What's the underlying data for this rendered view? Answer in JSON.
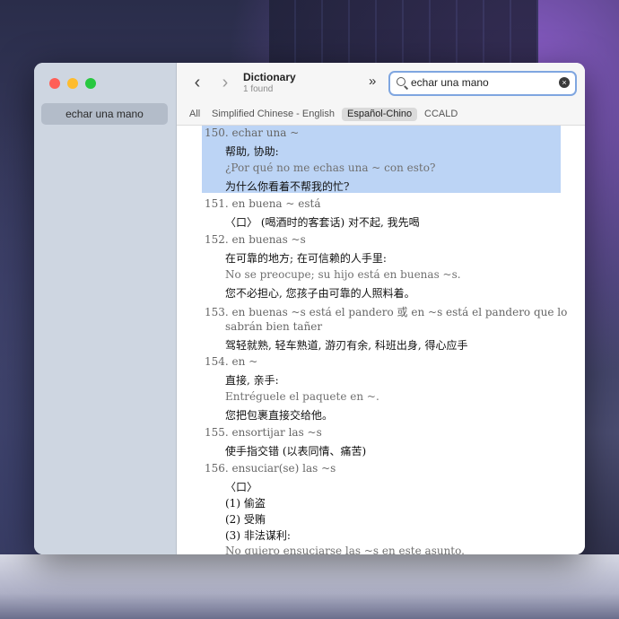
{
  "window": {
    "sidebar": {
      "items": [
        {
          "label": "echar una mano"
        }
      ]
    },
    "toolbar": {
      "back_icon": "chevron-left-icon",
      "forward_icon": "chevron-right-icon",
      "title": "Dictionary",
      "subtitle": "1 found",
      "more_icon": "double-chevron-right-icon"
    },
    "search": {
      "value": "echar una mano",
      "icon": "search-icon",
      "clear_icon": "clear-icon"
    },
    "tabs": [
      {
        "label": "All"
      },
      {
        "label": "Simplified Chinese - English"
      },
      {
        "label": "Español-Chino",
        "active": true
      },
      {
        "label": "CCALD"
      }
    ]
  },
  "entries": {
    "e150": {
      "num": "150.",
      "head": "echar una ~",
      "def": "帮助, 协助:",
      "ex": "¿Por qué no me echas una ~ con esto?",
      "tr": "为什么你看着不帮我的忙?"
    },
    "e151": {
      "num": "151.",
      "head": "en buena ~ está",
      "def": "〈口〉 (喝酒时的客套话) 对不起, 我先喝"
    },
    "e152": {
      "num": "152.",
      "head": "en buenas ~s",
      "def": "在可靠的地方; 在可信赖的人手里:",
      "ex": "No se preocupe; su hijo está en buenas ~s.",
      "tr": "您不必担心, 您孩子由可靠的人照料着。"
    },
    "e153": {
      "num": "153.",
      "head_a": "en buenas ~s está el pandero",
      "or_word": "或",
      "head_b": "en ~s está el pandero que lo",
      "head_c": "sabrán bien tañer",
      "def": "驾轻就熟, 轻车熟道, 游刃有余, 科班出身, 得心应手"
    },
    "e154": {
      "num": "154.",
      "head": "en ~",
      "def": "直接, 亲手:",
      "ex": "Entréguele el paquete en ~.",
      "tr": "您把包裹直接交给他。"
    },
    "e155": {
      "num": "155.",
      "head": "ensortijar las ~s",
      "def": "使手指交错 (以表同情、痛苦)"
    },
    "e156": {
      "num": "156.",
      "head": "ensuciar(se) las ~s",
      "tag": "〈口〉",
      "s1": "(1) 偷盗",
      "s2": "(2) 受贿",
      "s3": "(3) 非法谋利:",
      "ex": "No quiero ensuciarse las ~s en este asunto."
    }
  }
}
